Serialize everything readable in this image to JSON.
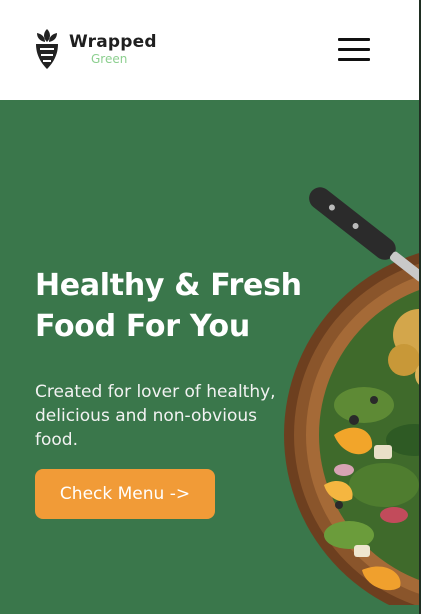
{
  "header": {
    "logo_word": "Wrapped",
    "logo_sub": "Green",
    "menu_icon": "hamburger-menu-icon"
  },
  "hero": {
    "title_line1": "Healthy & Fresh",
    "title_line2": "Food For You",
    "subtitle": "Created for lover of healthy, delicious and non-obvious food.",
    "cta_label": "Check Menu ->",
    "image_icon": "salad-bowl-with-fork-image"
  },
  "colors": {
    "hero_bg": "#3a774b",
    "cta_bg": "#f19b37",
    "logo_sub": "#8ccf8f",
    "text_dark": "#1f1f1f"
  }
}
